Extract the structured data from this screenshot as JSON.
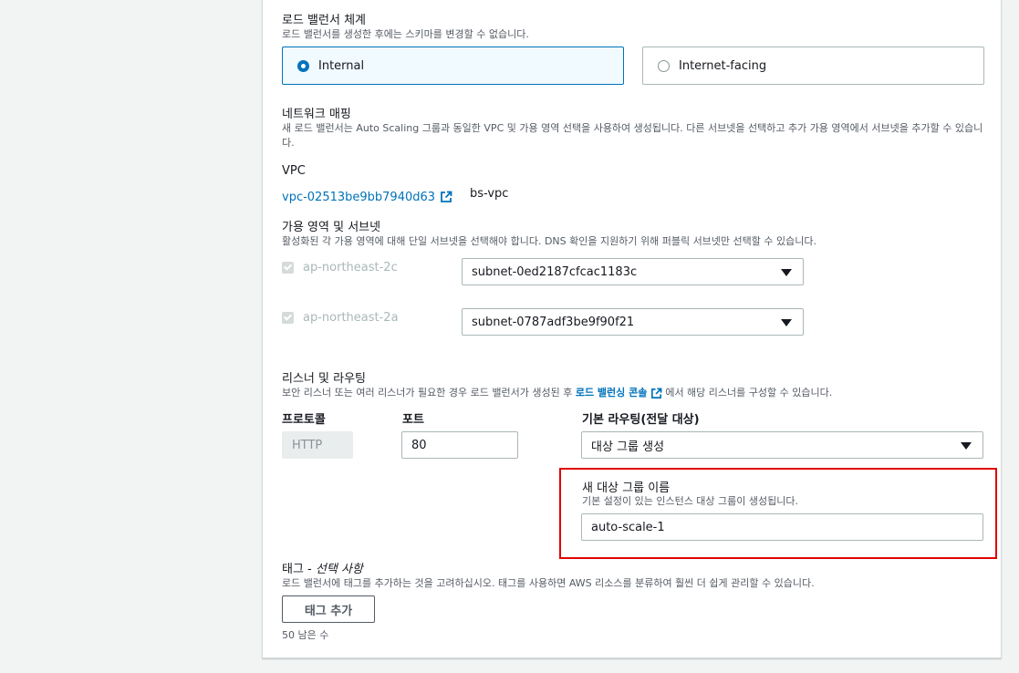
{
  "scheme": {
    "title": "로드 밸런서 체계",
    "description": "로드 밸런서를 생성한 후에는 스키마를 변경할 수 없습니다.",
    "options": [
      {
        "label": "Internal",
        "selected": true
      },
      {
        "label": "Internet-facing",
        "selected": false
      }
    ]
  },
  "network_mapping": {
    "title": "네트워크 매핑",
    "description": "새 로드 밸런서는 Auto Scaling 그룹과 동일한 VPC 및 가용 영역 선택을 사용하여 생성됩니다. 다른 서브넷을 선택하고 추가 가용 영역에서 서브넷을 추가할 수 있습니다."
  },
  "vpc": {
    "label": "VPC",
    "id": "vpc-02513be9bb7940d63",
    "name": "bs-vpc"
  },
  "az_subnets": {
    "title": "가용 영역 및 서브넷",
    "description": "활성화된 각 가용 영역에 대해 단일 서브넷을 선택해야 합니다. DNS 확인을 지원하기 위해 퍼블릭 서브넷만 선택할 수 있습니다.",
    "zones": [
      {
        "zone": "ap-northeast-2c",
        "subnet": "subnet-0ed2187cfcac1183c",
        "checked": true
      },
      {
        "zone": "ap-northeast-2a",
        "subnet": "subnet-0787adf3be9f90f21",
        "checked": true
      }
    ]
  },
  "listeners": {
    "title": "리스너 및 라우팅",
    "description_before": "보안 리스너 또는 여러 리스너가 필요한 경우 로드 밸런서가 생성된 후 ",
    "console_link": "로드 밸런싱 콘솔",
    "description_after": " 에서 해당 리스너를 구성할 수 있습니다.",
    "protocol_label": "프로토콜",
    "protocol_value": "HTTP",
    "port_label": "포트",
    "port_value": "80",
    "routing_label": "기본 라우팅(전달 대상)",
    "routing_value": "대상 그룹 생성"
  },
  "target_group": {
    "title": "새 대상 그룹 이름",
    "description": "기본 설정이 있는 인스턴스 대상 그룹이 생성됩니다.",
    "value": "auto-scale-1"
  },
  "tags": {
    "title": "태그 - ",
    "title_optional": "선택 사항",
    "description": "로드 밸런서에 태그를 추가하는 것을 고려하십시오. 태그를 사용하면 AWS 리소스를 분류하여 훨씬 더 쉽게 관리할 수 있습니다.",
    "add_button": "태그 추가",
    "remaining": "50 남은 수"
  },
  "colors": {
    "accent": "#0073bb",
    "highlight": "#e00000"
  }
}
